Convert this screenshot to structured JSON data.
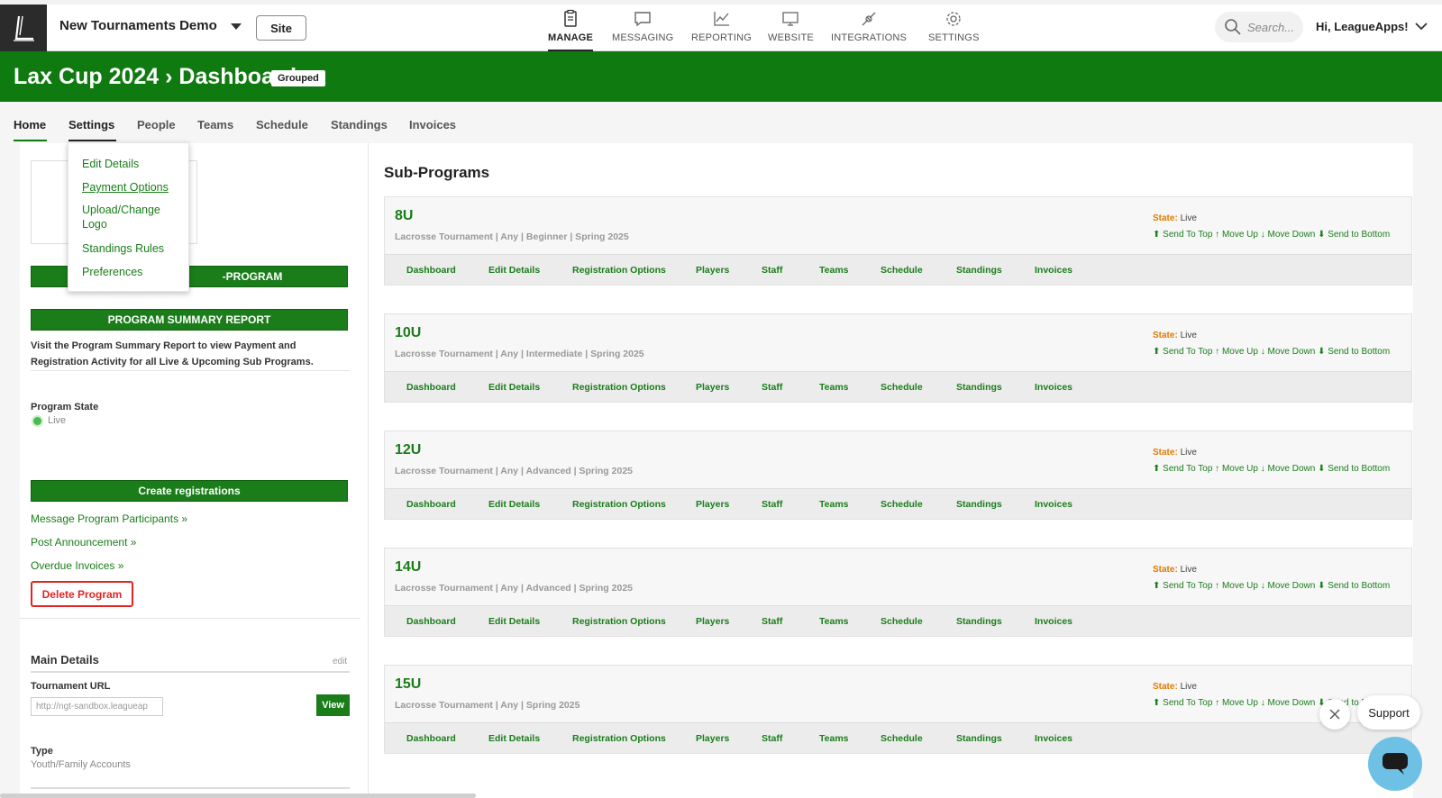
{
  "topbar": {
    "org_name": "New Tournaments Demo",
    "site_label": "Site",
    "nav": [
      {
        "label": "MANAGE",
        "icon": "clipboard-icon"
      },
      {
        "label": "MESSAGING",
        "icon": "message-icon"
      },
      {
        "label": "REPORTING",
        "icon": "chart-icon"
      },
      {
        "label": "WEBSITE",
        "icon": "monitor-icon"
      },
      {
        "label": "INTEGRATIONS",
        "icon": "plug-icon"
      },
      {
        "label": "SETTINGS",
        "icon": "gear-icon"
      }
    ],
    "search_placeholder": "Search...",
    "greeting": "Hi, LeagueApps!"
  },
  "banner": {
    "title": "Lax Cup 2024 › Dashboard",
    "badge": "Grouped"
  },
  "tabs": [
    "Home",
    "Settings",
    "People",
    "Teams",
    "Schedule",
    "Standings",
    "Invoices"
  ],
  "settings_menu": [
    "Edit Details",
    "Payment Options",
    "Upload/Change Logo",
    "Standings Rules",
    "Preferences"
  ],
  "left": {
    "subprogram_btn": "-PROGRAM",
    "summary_btn": "PROGRAM SUMMARY REPORT",
    "summary_text": "Visit the Program Summary Report to view Payment and Registration Activity for all Live & Upcoming Sub Programs.",
    "program_state_label": "Program State",
    "program_state_value": "Live",
    "create_btn": "Create registrations",
    "links": [
      "Message Program Participants »",
      "Post Announcement »",
      "Overdue Invoices »"
    ],
    "delete_btn": "Delete Program",
    "main_details": "Main Details",
    "edit": "edit",
    "tournament_url_label": "Tournament URL",
    "tournament_url_value": "http://ngt-sandbox.leagueap",
    "view_btn": "View",
    "type_label": "Type",
    "type_value": "Youth/Family Accounts"
  },
  "subprograms": {
    "title": "Sub-Programs",
    "state_label": "State:",
    "moves": "⬆ Send To Top ↑ Move Up ↓ Move Down ⬇ Send to Bottom",
    "links": [
      "Dashboard",
      "Edit Details",
      "Registration Options",
      "Players",
      "Staff",
      "Teams",
      "Schedule",
      "Standings",
      "Invoices"
    ],
    "items": [
      {
        "name": "8U",
        "desc": "Lacrosse Tournament | Any | Beginner | Spring 2025",
        "state": "Live"
      },
      {
        "name": "10U",
        "desc": "Lacrosse Tournament | Any | Intermediate | Spring 2025",
        "state": "Live"
      },
      {
        "name": "12U",
        "desc": "Lacrosse Tournament | Any | Advanced | Spring 2025",
        "state": "Live"
      },
      {
        "name": "14U",
        "desc": "Lacrosse Tournament | Any | Advanced | Spring 2025",
        "state": "Live"
      },
      {
        "name": "15U",
        "desc": "Lacrosse Tournament | Any | Spring 2025",
        "state": "Live"
      }
    ]
  },
  "support": {
    "label": "Support"
  }
}
